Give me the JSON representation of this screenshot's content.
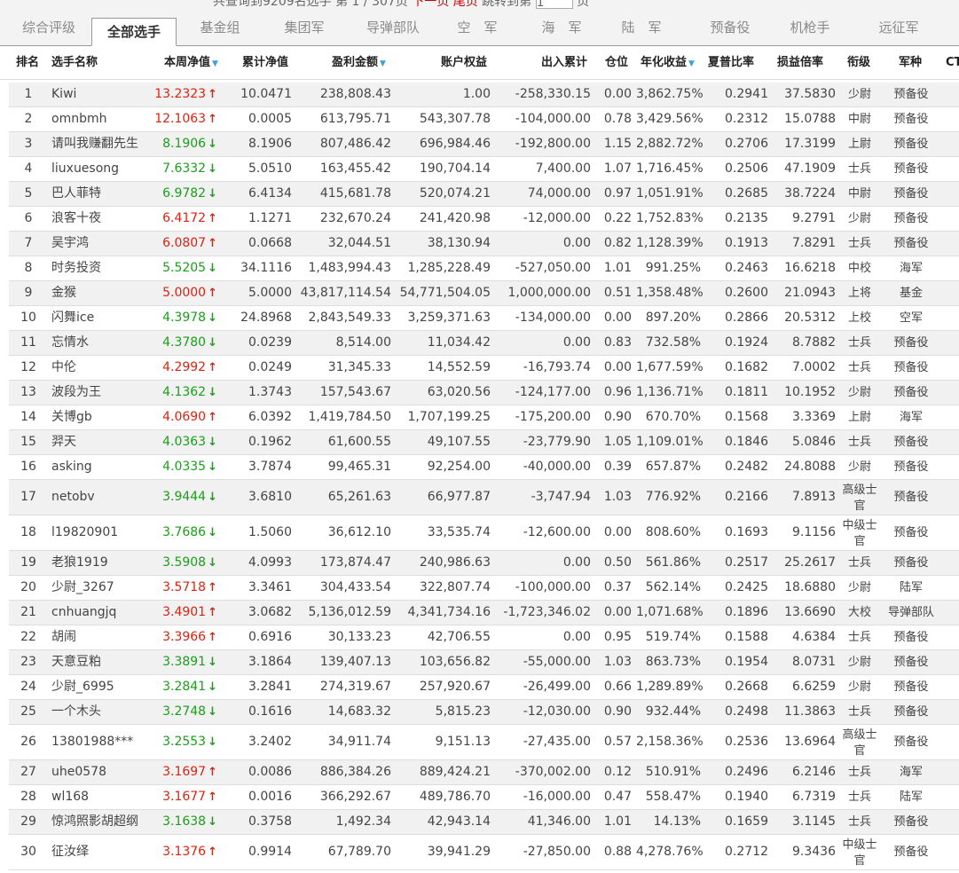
{
  "top_bar": {
    "text_left": "共查询到9209名选手",
    "page_prefix": "第",
    "page_current": "1",
    "page_total_text": "/ 307页",
    "link_next": "下一页",
    "link_last": "尾页",
    "goto_label": "跳转到第",
    "goto_value": "1",
    "page_suffix": "页"
  },
  "tabs": [
    "综合评级",
    "全部选手",
    "基金组",
    "集团军",
    "导弹部队",
    "空　军",
    "海　军",
    "陆　军",
    "预备役",
    "机枪手",
    "远征军"
  ],
  "active_tab_index": 1,
  "columns": [
    {
      "key": "rank",
      "label": "排名"
    },
    {
      "key": "name",
      "label": "选手名称"
    },
    {
      "key": "nav",
      "label": "本周净值",
      "sortable": true
    },
    {
      "key": "cum_nav",
      "label": "累计净值"
    },
    {
      "key": "profit",
      "label": "盈利金额",
      "sortable": true
    },
    {
      "key": "equity",
      "label": "账户权益"
    },
    {
      "key": "flow",
      "label": "出入累计"
    },
    {
      "key": "position",
      "label": "仓位"
    },
    {
      "key": "annual",
      "label": "年化收益",
      "sortable": true
    },
    {
      "key": "sharpe",
      "label": "夏普比率"
    },
    {
      "key": "pl_ratio",
      "label": "损益倍率"
    },
    {
      "key": "rank_title",
      "label": "衔级"
    },
    {
      "key": "branch",
      "label": "军种"
    },
    {
      "key": "extra",
      "label": "CT"
    }
  ],
  "arrow_up": "↑",
  "arrow_down": "↓",
  "rows": [
    {
      "rank": "1",
      "name": "Kiwi",
      "nav": "13.2323",
      "trend": "up",
      "cum_nav": "10.0471",
      "profit": "238,808.43",
      "equity": "1.00",
      "flow": "-258,330.15",
      "position": "0.00",
      "annual": "3,862.75%",
      "sharpe": "0.2941",
      "pl_ratio": "37.5830",
      "rank_title": "少尉",
      "branch": "预备役"
    },
    {
      "rank": "2",
      "name": "omnbmh",
      "nav": "12.1063",
      "trend": "up",
      "cum_nav": "0.0005",
      "profit": "613,795.71",
      "equity": "543,307.78",
      "flow": "-104,000.00",
      "position": "0.78",
      "annual": "3,429.56%",
      "sharpe": "0.2312",
      "pl_ratio": "15.0788",
      "rank_title": "中尉",
      "branch": "预备役"
    },
    {
      "rank": "3",
      "name": "请叫我赚翻先生",
      "nav": "8.1906",
      "trend": "down",
      "cum_nav": "8.1906",
      "profit": "807,486.42",
      "equity": "696,984.46",
      "flow": "-192,800.00",
      "position": "1.15",
      "annual": "2,882.72%",
      "sharpe": "0.2706",
      "pl_ratio": "17.3199",
      "rank_title": "上尉",
      "branch": "预备役"
    },
    {
      "rank": "4",
      "name": "liuxuesong",
      "nav": "7.6332",
      "trend": "down",
      "cum_nav": "5.0510",
      "profit": "163,455.42",
      "equity": "190,704.14",
      "flow": "7,400.00",
      "position": "1.07",
      "annual": "1,716.45%",
      "sharpe": "0.2506",
      "pl_ratio": "47.1909",
      "rank_title": "士兵",
      "branch": "预备役"
    },
    {
      "rank": "5",
      "name": "巴人菲特",
      "nav": "6.9782",
      "trend": "down",
      "cum_nav": "6.4134",
      "profit": "415,681.78",
      "equity": "520,074.21",
      "flow": "74,000.00",
      "position": "0.97",
      "annual": "1,051.91%",
      "sharpe": "0.2685",
      "pl_ratio": "38.7224",
      "rank_title": "中尉",
      "branch": "预备役"
    },
    {
      "rank": "6",
      "name": "浪客十夜",
      "nav": "6.4172",
      "trend": "up",
      "cum_nav": "1.1271",
      "profit": "232,670.24",
      "equity": "241,420.98",
      "flow": "-12,000.00",
      "position": "0.22",
      "annual": "1,752.83%",
      "sharpe": "0.2135",
      "pl_ratio": "9.2791",
      "rank_title": "少尉",
      "branch": "预备役"
    },
    {
      "rank": "7",
      "name": "吴宇鸿",
      "nav": "6.0807",
      "trend": "up",
      "cum_nav": "0.0668",
      "profit": "32,044.51",
      "equity": "38,130.94",
      "flow": "0.00",
      "position": "0.82",
      "annual": "1,128.39%",
      "sharpe": "0.1913",
      "pl_ratio": "7.8291",
      "rank_title": "士兵",
      "branch": "预备役"
    },
    {
      "rank": "8",
      "name": "时务投资",
      "nav": "5.5205",
      "trend": "down",
      "cum_nav": "34.1116",
      "profit": "1,483,994.43",
      "equity": "1,285,228.49",
      "flow": "-527,050.00",
      "position": "1.01",
      "annual": "991.25%",
      "sharpe": "0.2463",
      "pl_ratio": "16.6218",
      "rank_title": "中校",
      "branch": "海军"
    },
    {
      "rank": "9",
      "name": "金猴",
      "nav": "5.0000",
      "trend": "up",
      "cum_nav": "5.0000",
      "profit": "43,817,114.54",
      "equity": "54,771,504.05",
      "flow": "1,000,000.00",
      "position": "0.51",
      "annual": "1,358.48%",
      "sharpe": "0.2600",
      "pl_ratio": "21.0943",
      "rank_title": "上将",
      "branch": "基金"
    },
    {
      "rank": "10",
      "name": "闪舞ice",
      "nav": "4.3978",
      "trend": "down",
      "cum_nav": "24.8968",
      "profit": "2,843,549.33",
      "equity": "3,259,371.63",
      "flow": "-134,000.00",
      "position": "0.00",
      "annual": "897.20%",
      "sharpe": "0.2866",
      "pl_ratio": "20.5312",
      "rank_title": "上校",
      "branch": "空军"
    },
    {
      "rank": "11",
      "name": "忘情水",
      "nav": "4.3780",
      "trend": "down",
      "cum_nav": "0.0239",
      "profit": "8,514.00",
      "equity": "11,034.42",
      "flow": "0.00",
      "position": "0.83",
      "annual": "732.58%",
      "sharpe": "0.1924",
      "pl_ratio": "8.7882",
      "rank_title": "士兵",
      "branch": "预备役"
    },
    {
      "rank": "12",
      "name": "中伦",
      "nav": "4.2992",
      "trend": "up",
      "cum_nav": "0.0249",
      "profit": "31,345.33",
      "equity": "14,552.59",
      "flow": "-16,793.74",
      "position": "0.00",
      "annual": "1,677.59%",
      "sharpe": "0.1682",
      "pl_ratio": "7.0002",
      "rank_title": "士兵",
      "branch": "预备役"
    },
    {
      "rank": "13",
      "name": "波段为王",
      "nav": "4.1362",
      "trend": "down",
      "cum_nav": "1.3743",
      "profit": "157,543.67",
      "equity": "63,020.56",
      "flow": "-124,177.00",
      "position": "0.96",
      "annual": "1,136.71%",
      "sharpe": "0.1811",
      "pl_ratio": "10.1952",
      "rank_title": "少尉",
      "branch": "预备役"
    },
    {
      "rank": "14",
      "name": "关博gb",
      "nav": "4.0690",
      "trend": "up",
      "cum_nav": "6.0392",
      "profit": "1,419,784.50",
      "equity": "1,707,199.25",
      "flow": "-175,200.00",
      "position": "0.90",
      "annual": "670.70%",
      "sharpe": "0.1568",
      "pl_ratio": "3.3369",
      "rank_title": "上尉",
      "branch": "海军"
    },
    {
      "rank": "15",
      "name": "羿天",
      "nav": "4.0363",
      "trend": "down",
      "cum_nav": "0.1962",
      "profit": "61,600.55",
      "equity": "49,107.55",
      "flow": "-23,779.90",
      "position": "1.05",
      "annual": "1,109.01%",
      "sharpe": "0.1846",
      "pl_ratio": "5.0846",
      "rank_title": "士兵",
      "branch": "预备役"
    },
    {
      "rank": "16",
      "name": "asking",
      "nav": "4.0335",
      "trend": "down",
      "cum_nav": "3.7874",
      "profit": "99,465.31",
      "equity": "92,254.00",
      "flow": "-40,000.00",
      "position": "0.39",
      "annual": "657.87%",
      "sharpe": "0.2482",
      "pl_ratio": "24.8088",
      "rank_title": "少尉",
      "branch": "预备役"
    },
    {
      "rank": "17",
      "name": "netobv",
      "nav": "3.9444",
      "trend": "down",
      "cum_nav": "3.6810",
      "profit": "65,261.63",
      "equity": "66,977.87",
      "flow": "-3,747.94",
      "position": "1.03",
      "annual": "776.92%",
      "sharpe": "0.2166",
      "pl_ratio": "7.8913",
      "rank_title": "高级士官",
      "branch": "预备役"
    },
    {
      "rank": "18",
      "name": "l19820901",
      "nav": "3.7686",
      "trend": "down",
      "cum_nav": "1.5060",
      "profit": "36,612.10",
      "equity": "33,535.74",
      "flow": "-12,600.00",
      "position": "0.00",
      "annual": "808.60%",
      "sharpe": "0.1693",
      "pl_ratio": "9.1156",
      "rank_title": "中级士官",
      "branch": "预备役"
    },
    {
      "rank": "19",
      "name": "老狼1919",
      "nav": "3.5908",
      "trend": "down",
      "cum_nav": "4.0993",
      "profit": "173,874.47",
      "equity": "240,986.63",
      "flow": "0.00",
      "position": "0.50",
      "annual": "561.86%",
      "sharpe": "0.2517",
      "pl_ratio": "25.2617",
      "rank_title": "士兵",
      "branch": "预备役"
    },
    {
      "rank": "20",
      "name": "少尉_3267",
      "nav": "3.5718",
      "trend": "up",
      "cum_nav": "3.3461",
      "profit": "304,433.54",
      "equity": "322,807.74",
      "flow": "-100,000.00",
      "position": "0.37",
      "annual": "562.14%",
      "sharpe": "0.2425",
      "pl_ratio": "18.6880",
      "rank_title": "少尉",
      "branch": "陆军"
    },
    {
      "rank": "21",
      "name": "cnhuangjq",
      "nav": "3.4901",
      "trend": "up",
      "cum_nav": "3.0682",
      "profit": "5,136,012.59",
      "equity": "4,341,734.16",
      "flow": "-1,723,346.02",
      "position": "0.00",
      "annual": "1,071.68%",
      "sharpe": "0.1896",
      "pl_ratio": "13.6690",
      "rank_title": "大校",
      "branch": "导弹部队"
    },
    {
      "rank": "22",
      "name": "胡闹",
      "nav": "3.3966",
      "trend": "up",
      "cum_nav": "0.6916",
      "profit": "30,133.23",
      "equity": "42,706.55",
      "flow": "0.00",
      "position": "0.95",
      "annual": "519.74%",
      "sharpe": "0.1588",
      "pl_ratio": "4.6384",
      "rank_title": "士兵",
      "branch": "预备役"
    },
    {
      "rank": "23",
      "name": "天意豆粕",
      "nav": "3.3891",
      "trend": "down",
      "cum_nav": "3.1864",
      "profit": "139,407.13",
      "equity": "103,656.82",
      "flow": "-55,000.00",
      "position": "1.03",
      "annual": "863.73%",
      "sharpe": "0.1954",
      "pl_ratio": "8.0731",
      "rank_title": "少尉",
      "branch": "预备役"
    },
    {
      "rank": "24",
      "name": "少尉_6995",
      "nav": "3.2841",
      "trend": "down",
      "cum_nav": "3.2841",
      "profit": "274,319.67",
      "equity": "257,920.67",
      "flow": "-26,499.00",
      "position": "0.66",
      "annual": "1,289.89%",
      "sharpe": "0.2668",
      "pl_ratio": "6.6259",
      "rank_title": "少尉",
      "branch": "预备役"
    },
    {
      "rank": "25",
      "name": "一个木头",
      "nav": "3.2748",
      "trend": "down",
      "cum_nav": "0.1616",
      "profit": "14,683.32",
      "equity": "5,815.23",
      "flow": "-12,030.00",
      "position": "0.90",
      "annual": "932.44%",
      "sharpe": "0.2498",
      "pl_ratio": "11.3863",
      "rank_title": "士兵",
      "branch": "预备役"
    },
    {
      "rank": "26",
      "name": "13801988***",
      "nav": "3.2553",
      "trend": "down",
      "cum_nav": "3.2402",
      "profit": "34,911.74",
      "equity": "9,151.13",
      "flow": "-27,435.00",
      "position": "0.57",
      "annual": "2,158.36%",
      "sharpe": "0.2536",
      "pl_ratio": "13.6964",
      "rank_title": "高级士官",
      "branch": "预备役"
    },
    {
      "rank": "27",
      "name": "uhe0578",
      "nav": "3.1697",
      "trend": "up",
      "cum_nav": "0.0086",
      "profit": "886,384.26",
      "equity": "889,424.21",
      "flow": "-370,002.00",
      "position": "0.12",
      "annual": "510.91%",
      "sharpe": "0.2496",
      "pl_ratio": "6.2146",
      "rank_title": "士兵",
      "branch": "海军"
    },
    {
      "rank": "28",
      "name": "wl168",
      "nav": "3.1677",
      "trend": "up",
      "cum_nav": "0.0016",
      "profit": "366,292.67",
      "equity": "489,786.70",
      "flow": "-16,000.00",
      "position": "0.47",
      "annual": "558.47%",
      "sharpe": "0.1940",
      "pl_ratio": "6.7319",
      "rank_title": "士兵",
      "branch": "陆军"
    },
    {
      "rank": "29",
      "name": "惊鸿照影胡超纲",
      "nav": "3.1638",
      "trend": "down",
      "cum_nav": "0.3758",
      "profit": "1,492.34",
      "equity": "42,943.14",
      "flow": "41,346.00",
      "position": "1.01",
      "annual": "14.13%",
      "sharpe": "0.1659",
      "pl_ratio": "3.1145",
      "rank_title": "士兵",
      "branch": "预备役"
    },
    {
      "rank": "30",
      "name": "征汝绎",
      "nav": "3.1376",
      "trend": "up",
      "cum_nav": "0.9914",
      "profit": "67,789.70",
      "equity": "39,941.29",
      "flow": "-27,850.00",
      "position": "0.88",
      "annual": "4,278.76%",
      "sharpe": "0.2712",
      "pl_ratio": "9.3436",
      "rank_title": "中级士官",
      "branch": "预备役"
    }
  ],
  "colors": {
    "up": "#d21111",
    "down": "#19a019",
    "sort_arrow": "#3aa2d8",
    "row_alt": "#f1f1f1"
  }
}
